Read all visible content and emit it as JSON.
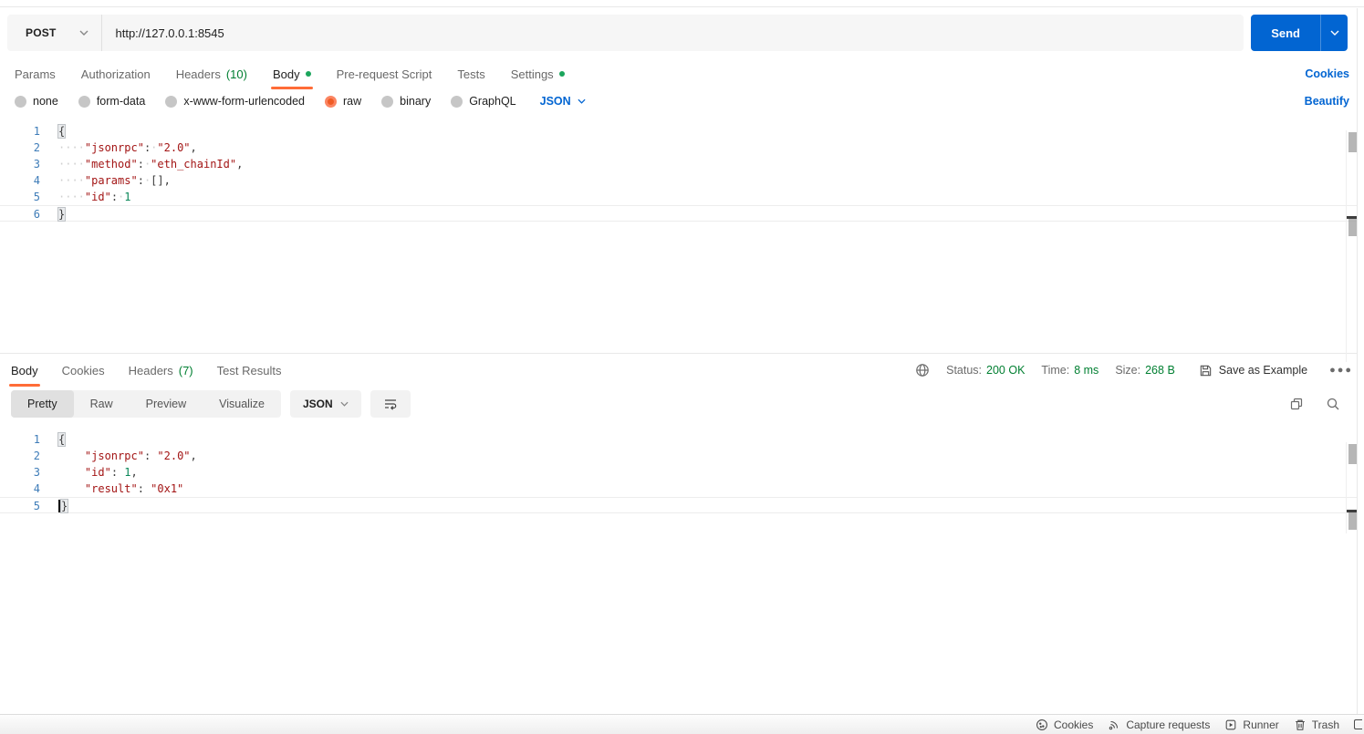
{
  "request": {
    "method": "POST",
    "url": "http://127.0.0.1:8545",
    "send_label": "Send",
    "tabs": [
      {
        "label": "Params"
      },
      {
        "label": "Authorization"
      },
      {
        "label": "Headers",
        "count": "(10)"
      },
      {
        "label": "Body"
      },
      {
        "label": "Pre-request Script"
      },
      {
        "label": "Tests"
      },
      {
        "label": "Settings"
      }
    ],
    "cookies_link": "Cookies",
    "body_types": [
      "none",
      "form-data",
      "x-www-form-urlencoded",
      "raw",
      "binary",
      "GraphQL"
    ],
    "selected_body_type": "raw",
    "language": "JSON",
    "beautify_link": "Beautify",
    "editor": {
      "lines": [
        {
          "num": "1",
          "tokens": [
            {
              "t": "brkt",
              "v": "{"
            }
          ]
        },
        {
          "num": "2",
          "tokens": [
            {
              "t": "ws",
              "v": "····"
            },
            {
              "t": "str",
              "v": "\"jsonrpc\""
            },
            {
              "t": "pun",
              "v": ":"
            },
            {
              "t": "ws",
              "v": "·"
            },
            {
              "t": "str",
              "v": "\"2.0\""
            },
            {
              "t": "pun",
              "v": ","
            }
          ]
        },
        {
          "num": "3",
          "tokens": [
            {
              "t": "ws",
              "v": "····"
            },
            {
              "t": "str",
              "v": "\"method\""
            },
            {
              "t": "pun",
              "v": ":"
            },
            {
              "t": "ws",
              "v": "·"
            },
            {
              "t": "str",
              "v": "\"eth_chainId\""
            },
            {
              "t": "pun",
              "v": ","
            }
          ]
        },
        {
          "num": "4",
          "tokens": [
            {
              "t": "ws",
              "v": "····"
            },
            {
              "t": "str",
              "v": "\"params\""
            },
            {
              "t": "pun",
              "v": ":"
            },
            {
              "t": "ws",
              "v": "·"
            },
            {
              "t": "pun",
              "v": "[],"
            }
          ]
        },
        {
          "num": "5",
          "tokens": [
            {
              "t": "ws",
              "v": "····"
            },
            {
              "t": "str",
              "v": "\"id\""
            },
            {
              "t": "pun",
              "v": ":"
            },
            {
              "t": "ws",
              "v": "·"
            },
            {
              "t": "num",
              "v": "1"
            }
          ]
        },
        {
          "num": "6",
          "active": true,
          "tokens": [
            {
              "t": "brkt",
              "v": "}"
            }
          ]
        }
      ]
    }
  },
  "response": {
    "tabs": [
      {
        "label": "Body"
      },
      {
        "label": "Cookies"
      },
      {
        "label": "Headers",
        "count": "(7)"
      },
      {
        "label": "Test Results"
      }
    ],
    "meta": {
      "status_label": "Status:",
      "status_value": "200 OK",
      "time_label": "Time:",
      "time_value": "8 ms",
      "size_label": "Size:",
      "size_value": "268 B",
      "save_as_example": "Save as Example"
    },
    "views": [
      "Pretty",
      "Raw",
      "Preview",
      "Visualize"
    ],
    "selected_view": "Pretty",
    "language": "JSON",
    "editor": {
      "lines": [
        {
          "num": "1",
          "tokens": [
            {
              "t": "brkt",
              "v": "{"
            }
          ]
        },
        {
          "num": "2",
          "tokens": [
            {
              "t": "sp",
              "v": "    "
            },
            {
              "t": "str",
              "v": "\"jsonrpc\""
            },
            {
              "t": "pun",
              "v": ": "
            },
            {
              "t": "str",
              "v": "\"2.0\""
            },
            {
              "t": "pun",
              "v": ","
            }
          ]
        },
        {
          "num": "3",
          "tokens": [
            {
              "t": "sp",
              "v": "    "
            },
            {
              "t": "str",
              "v": "\"id\""
            },
            {
              "t": "pun",
              "v": ": "
            },
            {
              "t": "num",
              "v": "1"
            },
            {
              "t": "pun",
              "v": ","
            }
          ]
        },
        {
          "num": "4",
          "tokens": [
            {
              "t": "sp",
              "v": "    "
            },
            {
              "t": "str",
              "v": "\"result\""
            },
            {
              "t": "pun",
              "v": ": "
            },
            {
              "t": "str",
              "v": "\"0x1\""
            }
          ]
        },
        {
          "num": "5",
          "active": true,
          "tokens": [
            {
              "t": "caret",
              "v": ""
            },
            {
              "t": "brkt",
              "v": "}"
            }
          ]
        }
      ]
    }
  },
  "footer": {
    "items": [
      "Cookies",
      "Capture requests",
      "Runner",
      "Trash"
    ]
  },
  "colors": {
    "accent_orange": "#FF6C37",
    "accent_blue": "#0265D2",
    "success_green": "#007F31",
    "code_string": "#A31515",
    "code_number": "#098658",
    "line_number": "#3E7CB8"
  }
}
